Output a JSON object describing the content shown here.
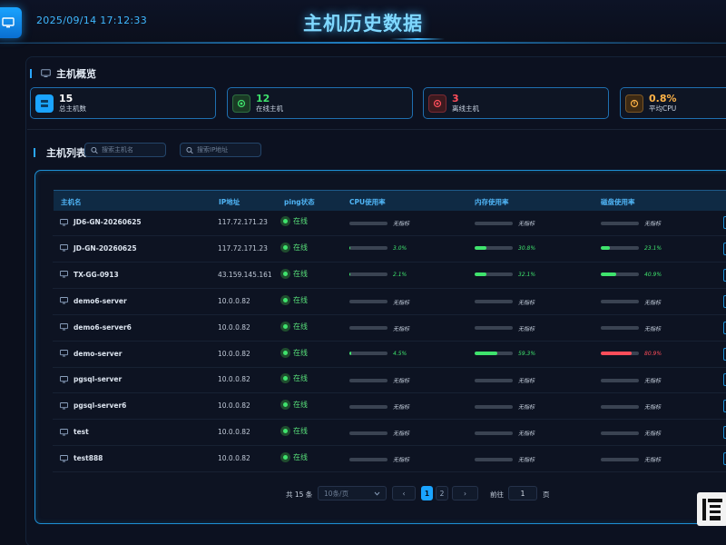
{
  "header": {
    "datetime": "2025/09/14 17:12:33",
    "title": "主机历史数据"
  },
  "overview": {
    "title": "主机概览",
    "cards": [
      {
        "value": "15",
        "label": "总主机数",
        "color": "#1aa4ff",
        "icon": "server-icon"
      },
      {
        "value": "12",
        "label": "在线主机",
        "color": "#3fe36d",
        "icon": "online-icon"
      },
      {
        "value": "3",
        "label": "离线主机",
        "color": "#ff4d5a",
        "icon": "offline-icon"
      },
      {
        "value": "0.8%",
        "label": "平均CPU",
        "color": "#ffb347",
        "icon": "cpu-icon"
      }
    ]
  },
  "hosts": {
    "title": "主机列表",
    "search_name_placeholder": "搜索主机名",
    "search_ip_placeholder": "搜索IP地址",
    "columns": [
      "主机名",
      "IP地址",
      "ping状态",
      "CPU使用率",
      "内存使用率",
      "磁盘使用率"
    ],
    "rows": [
      {
        "name": "JD6-GN-20260625",
        "ip": "117.72.171.23",
        "ping": "在线",
        "cpu": {
          "text": "无指标",
          "pct": 0
        },
        "mem": {
          "text": "无指标",
          "pct": 0
        },
        "disk": {
          "text": "无指标",
          "pct": 0
        }
      },
      {
        "name": "JD-GN-20260625",
        "ip": "117.72.171.23",
        "ping": "在线",
        "cpu": {
          "text": "3.0%",
          "pct": 3
        },
        "mem": {
          "text": "30.8%",
          "pct": 30.8
        },
        "disk": {
          "text": "23.1%",
          "pct": 23.1
        }
      },
      {
        "name": "TX-GG-0913",
        "ip": "43.159.145.161",
        "ping": "在线",
        "cpu": {
          "text": "2.1%",
          "pct": 2.1
        },
        "mem": {
          "text": "32.1%",
          "pct": 32.1
        },
        "disk": {
          "text": "40.9%",
          "pct": 40.9
        }
      },
      {
        "name": "demo6-server",
        "ip": "10.0.0.82",
        "ping": "在线",
        "cpu": {
          "text": "无指标",
          "pct": 0
        },
        "mem": {
          "text": "无指标",
          "pct": 0
        },
        "disk": {
          "text": "无指标",
          "pct": 0
        }
      },
      {
        "name": "demo6-server6",
        "ip": "10.0.0.82",
        "ping": "在线",
        "cpu": {
          "text": "无指标",
          "pct": 0
        },
        "mem": {
          "text": "无指标",
          "pct": 0
        },
        "disk": {
          "text": "无指标",
          "pct": 0
        }
      },
      {
        "name": "demo-server",
        "ip": "10.0.0.82",
        "ping": "在线",
        "cpu": {
          "text": "4.5%",
          "pct": 4.5
        },
        "mem": {
          "text": "59.3%",
          "pct": 59.3
        },
        "disk": {
          "text": "80.9%",
          "pct": 80.9
        }
      },
      {
        "name": "pgsql-server",
        "ip": "10.0.0.82",
        "ping": "在线",
        "cpu": {
          "text": "无指标",
          "pct": 0
        },
        "mem": {
          "text": "无指标",
          "pct": 0
        },
        "disk": {
          "text": "无指标",
          "pct": 0
        }
      },
      {
        "name": "pgsql-server6",
        "ip": "10.0.0.82",
        "ping": "在线",
        "cpu": {
          "text": "无指标",
          "pct": 0
        },
        "mem": {
          "text": "无指标",
          "pct": 0
        },
        "disk": {
          "text": "无指标",
          "pct": 0
        }
      },
      {
        "name": "test",
        "ip": "10.0.0.82",
        "ping": "在线",
        "cpu": {
          "text": "无指标",
          "pct": 0
        },
        "mem": {
          "text": "无指标",
          "pct": 0
        },
        "disk": {
          "text": "无指标",
          "pct": 0
        }
      },
      {
        "name": "test888",
        "ip": "10.0.0.82",
        "ping": "在线",
        "cpu": {
          "text": "无指标",
          "pct": 0
        },
        "mem": {
          "text": "无指标",
          "pct": 0
        },
        "disk": {
          "text": "无指标",
          "pct": 0
        }
      }
    ]
  },
  "pagination": {
    "total": "共 15 条",
    "page_size": "10条/页",
    "pages": [
      "1",
      "2"
    ],
    "current": "1",
    "goto_label": "前往",
    "goto_value": "1",
    "goto_suffix": "页",
    "prev": "‹",
    "next": "›"
  },
  "colors": {
    "accent": "#1aa4ff",
    "ok": "#3fe36d",
    "danger": "#ff4d5a",
    "warn": "#ffb347"
  }
}
